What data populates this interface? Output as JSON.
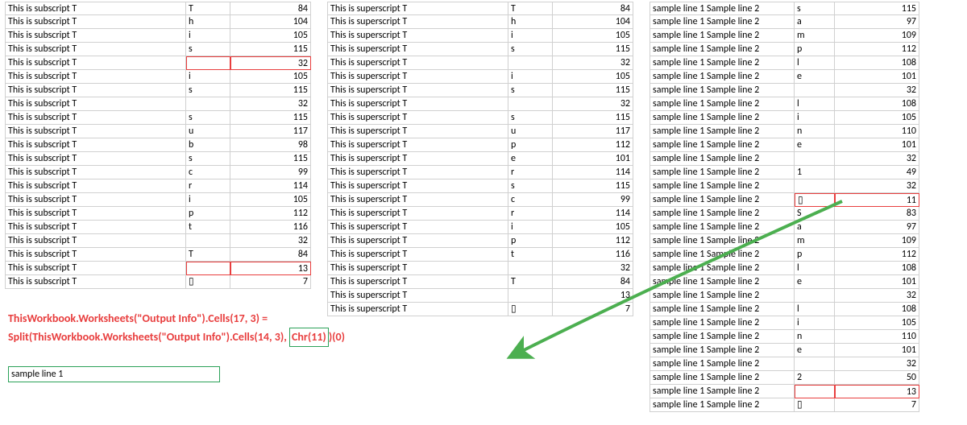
{
  "table_a": {
    "desc_label": "This is subscript T",
    "rows": [
      {
        "ch": "T",
        "num": 84
      },
      {
        "ch": "h",
        "num": 104
      },
      {
        "ch": "i",
        "num": 105
      },
      {
        "ch": "s",
        "num": 115
      },
      {
        "ch": "",
        "num": 32,
        "hl": true
      },
      {
        "ch": "i",
        "num": 105
      },
      {
        "ch": "s",
        "num": 115
      },
      {
        "ch": "",
        "num": 32
      },
      {
        "ch": "s",
        "num": 115
      },
      {
        "ch": "u",
        "num": 117
      },
      {
        "ch": "b",
        "num": 98
      },
      {
        "ch": "s",
        "num": 115
      },
      {
        "ch": "c",
        "num": 99
      },
      {
        "ch": "r",
        "num": 114
      },
      {
        "ch": "i",
        "num": 105
      },
      {
        "ch": "p",
        "num": 112
      },
      {
        "ch": "t",
        "num": 116
      },
      {
        "ch": "",
        "num": 32
      },
      {
        "ch": "T",
        "num": 84
      },
      {
        "ch": "",
        "num": 13,
        "hl": true
      },
      {
        "ch": "▯",
        "num": 7
      }
    ]
  },
  "table_b": {
    "desc_label": "This is superscript T",
    "rows": [
      {
        "ch": "T",
        "num": 84
      },
      {
        "ch": "h",
        "num": 104
      },
      {
        "ch": "i",
        "num": 105
      },
      {
        "ch": "s",
        "num": 115
      },
      {
        "ch": "",
        "num": 32
      },
      {
        "ch": "i",
        "num": 105
      },
      {
        "ch": "s",
        "num": 115
      },
      {
        "ch": "",
        "num": 32
      },
      {
        "ch": "s",
        "num": 115
      },
      {
        "ch": "u",
        "num": 117
      },
      {
        "ch": "p",
        "num": 112
      },
      {
        "ch": "e",
        "num": 101
      },
      {
        "ch": "r",
        "num": 114
      },
      {
        "ch": "s",
        "num": 115
      },
      {
        "ch": "c",
        "num": 99
      },
      {
        "ch": "r",
        "num": 114
      },
      {
        "ch": "i",
        "num": 105
      },
      {
        "ch": "p",
        "num": 112
      },
      {
        "ch": "t",
        "num": 116
      },
      {
        "ch": "",
        "num": 32
      },
      {
        "ch": "T",
        "num": 84
      },
      {
        "ch": "",
        "num": 13
      },
      {
        "ch": "▯",
        "num": 7
      }
    ]
  },
  "table_c": {
    "desc_label": "sample line 1 Sample line 2",
    "rows": [
      {
        "ch": "s",
        "num": 115
      },
      {
        "ch": "a",
        "num": 97
      },
      {
        "ch": "m",
        "num": 109
      },
      {
        "ch": "p",
        "num": 112
      },
      {
        "ch": "l",
        "num": 108
      },
      {
        "ch": "e",
        "num": 101
      },
      {
        "ch": "",
        "num": 32
      },
      {
        "ch": "l",
        "num": 108
      },
      {
        "ch": "i",
        "num": 105
      },
      {
        "ch": "n",
        "num": 110
      },
      {
        "ch": "e",
        "num": 101
      },
      {
        "ch": "",
        "num": 32
      },
      {
        "ch": "1",
        "num": 49
      },
      {
        "ch": "",
        "num": 32
      },
      {
        "ch": "▯",
        "num": 11,
        "hl": true
      },
      {
        "ch": "S",
        "num": 83
      },
      {
        "ch": "a",
        "num": 97
      },
      {
        "ch": "m",
        "num": 109
      },
      {
        "ch": "p",
        "num": 112
      },
      {
        "ch": "l",
        "num": 108
      },
      {
        "ch": "e",
        "num": 101
      },
      {
        "ch": "",
        "num": 32
      },
      {
        "ch": "l",
        "num": 108
      },
      {
        "ch": "i",
        "num": 105
      },
      {
        "ch": "n",
        "num": 110
      },
      {
        "ch": "e",
        "num": 101
      },
      {
        "ch": "",
        "num": 32
      },
      {
        "ch": "2",
        "num": 50
      },
      {
        "ch": "",
        "num": 13,
        "hl": true
      },
      {
        "ch": "▯",
        "num": 7
      }
    ]
  },
  "code": {
    "line1": "ThisWorkbook.Worksheets(\"Output Info\").Cells(17, 3) =",
    "line2_pre": "Split(ThisWorkbook.Worksheets(\"Output Info\").Cells(14, 3), ",
    "line2_chr": "Chr(11)",
    "line2_post": ")(0)"
  },
  "sample_box": "sample line 1",
  "colors": {
    "highlight_red": "#e83e3e",
    "highlight_green": "#2aa158",
    "arrow_green": "#4caf50"
  }
}
